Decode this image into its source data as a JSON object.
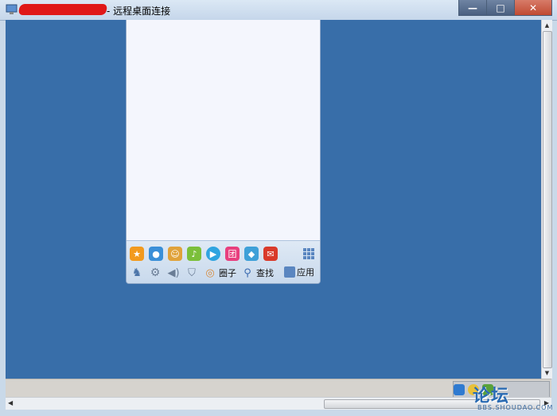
{
  "window": {
    "title_visible": "- 远程桌面连接",
    "controls": {
      "minimize": "—",
      "maximize": "□",
      "close": "✕"
    }
  },
  "qq_panel": {
    "toolbar_row1_icons": [
      "qzone-icon",
      "qq-friends-icon",
      "qq-pet-icon",
      "qq-music-icon",
      "qq-video-icon",
      "tuan-icon",
      "qq-guard-icon",
      "qq-mail-icon"
    ],
    "toolbar_row2": {
      "circle_label": "圈子",
      "search_label": "查找",
      "apps_label": "应用"
    }
  },
  "watermark": {
    "text": "论坛",
    "sub": "BBS.SHOUDAO.COM"
  },
  "colors": {
    "desktop": "#386ea9",
    "titlebar": "#c5d6ea",
    "close": "#c04a33"
  }
}
